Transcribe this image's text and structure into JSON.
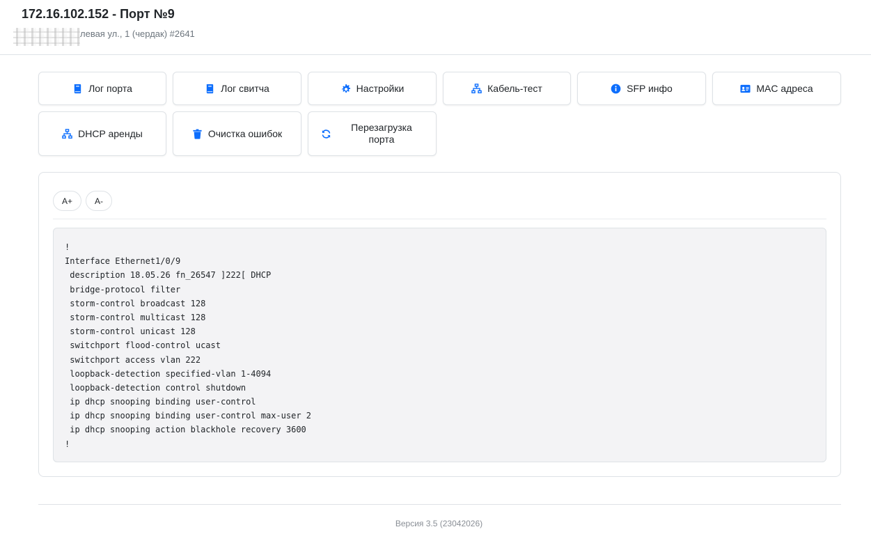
{
  "header": {
    "title": "172.16.102.152 - Порт №9",
    "address": "левая ул., 1 (чердак) #2641"
  },
  "actions": [
    {
      "label": "Лог порта",
      "icon": "book-icon"
    },
    {
      "label": "Лог свитча",
      "icon": "book-icon"
    },
    {
      "label": "Настройки",
      "icon": "gear-icon"
    },
    {
      "label": "Кабель-тест",
      "icon": "network-icon"
    },
    {
      "label": "SFP инфо",
      "icon": "info-circle-icon"
    },
    {
      "label": "MAC адреса",
      "icon": "id-card-icon"
    },
    {
      "label": "DHCP аренды",
      "icon": "network-icon"
    },
    {
      "label": "Очистка ошибок",
      "icon": "trash-icon"
    },
    {
      "label": "Перезагрузка порта",
      "icon": "refresh-icon"
    }
  ],
  "font_controls": {
    "increase": "A+",
    "decrease": "A-"
  },
  "config_lines": [
    "!",
    "Interface Ethernet1/0/9",
    " description 18.05.26 fn_26547 ]222[ DHCP",
    " bridge-protocol filter",
    " storm-control broadcast 128",
    " storm-control multicast 128",
    " storm-control unicast 128",
    " switchport flood-control ucast",
    " switchport access vlan 222",
    " loopback-detection specified-vlan 1-4094",
    " loopback-detection control shutdown",
    " ip dhcp snooping binding user-control",
    " ip dhcp snooping binding user-control max-user 2",
    " ip dhcp snooping action blackhole recovery 3600",
    "!"
  ],
  "footer": {
    "version": "Версия 3.5 (23042026)"
  },
  "colors": {
    "accent": "#0d6efd",
    "code_bg": "#f3f3f5",
    "border": "#dee2e6"
  }
}
